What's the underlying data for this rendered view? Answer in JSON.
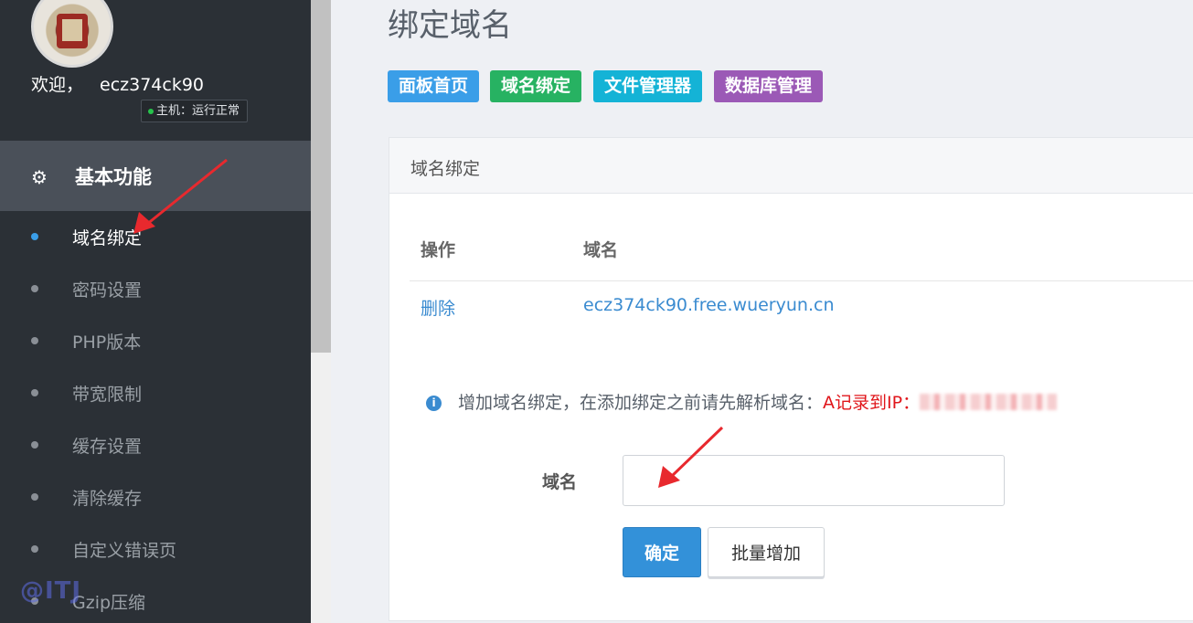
{
  "sidebar": {
    "welcome_label": "欢迎，",
    "username": "ecz374ck90",
    "host_status": "主机：运行正常",
    "section_title": "基本功能",
    "items": [
      {
        "label": "域名绑定",
        "active": true
      },
      {
        "label": "密码设置"
      },
      {
        "label": "PHP版本"
      },
      {
        "label": "带宽限制"
      },
      {
        "label": "缓存设置"
      },
      {
        "label": "清除缓存"
      },
      {
        "label": "自定义错误页"
      },
      {
        "label": "Gzip压缩"
      }
    ],
    "watermark": "@ITJ"
  },
  "main": {
    "page_title": "绑定域名",
    "top_buttons": [
      {
        "label": "面板首页",
        "color": "#3a9ee8"
      },
      {
        "label": "域名绑定",
        "color": "#27b262"
      },
      {
        "label": "文件管理器",
        "color": "#14b3d6"
      },
      {
        "label": "数据库管理",
        "color": "#9b59b6"
      }
    ],
    "panel": {
      "title": "域名绑定",
      "columns": [
        "操作",
        "域名"
      ],
      "rows": [
        {
          "action": "删除",
          "domain": "ecz374ck90.free.wueryun.cn"
        }
      ],
      "info_text": "增加域名绑定，在添加绑定之前请先解析域名：",
      "info_red": "A记录到IP：",
      "form": {
        "domain_label": "域名",
        "domain_value": "",
        "confirm_label": "确定",
        "batch_label": "批量增加"
      }
    }
  },
  "colors": {
    "sidebar_bg": "#2b3036",
    "section_bg": "#4a5059",
    "accent": "#3391d9",
    "annotation_arrow": "#e8292e"
  }
}
